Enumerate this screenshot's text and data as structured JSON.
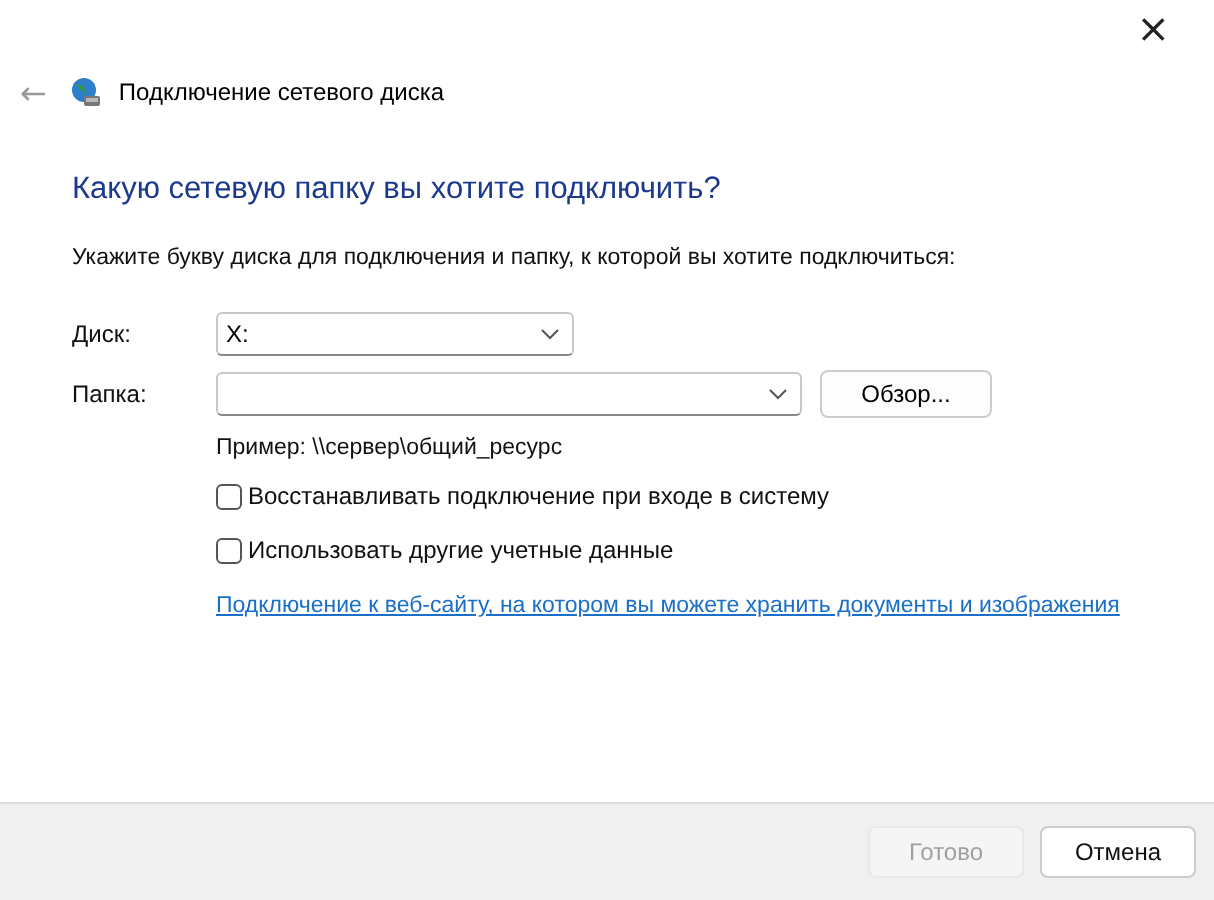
{
  "window": {
    "close": "×"
  },
  "header": {
    "back": "←",
    "title": "Подключение сетевого диска"
  },
  "heading": "Какую сетевую папку вы хотите подключить?",
  "instruction": "Укажите букву диска для подключения и папку, к которой вы хотите подключиться:",
  "drive": {
    "label": "Диск:",
    "value": "X:"
  },
  "folder": {
    "label": "Папка:",
    "browse": "Обзор..."
  },
  "example": "Пример: \\\\сервер\\общий_ресурс",
  "options": [
    {
      "label": "Восстанавливать подключение при входе в систему",
      "checked": false
    },
    {
      "label": "Использовать другие учетные данные",
      "checked": false
    }
  ],
  "link": "Подключение к веб-сайту, на котором вы можете хранить документы и изображения",
  "buttons": [
    {
      "label": "Готово",
      "disabled": true
    },
    {
      "label": "Отмена",
      "disabled": false
    }
  ]
}
